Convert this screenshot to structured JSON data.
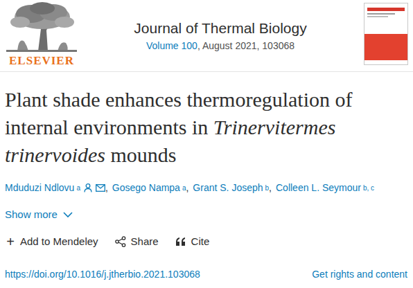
{
  "publisher": {
    "logo_text": "ELSEVIER"
  },
  "journal": {
    "title": "Journal of Thermal Biology",
    "volume_link": "Volume 100",
    "volume_rest": ", August 2021, 103068"
  },
  "article": {
    "title": [
      {
        "text": "Plant shade enhances thermoregulation of internal environments in ",
        "italic": false
      },
      {
        "text": "Trinervitermes trinervoides",
        "italic": true
      },
      {
        "text": " mounds",
        "italic": false
      }
    ]
  },
  "authors": [
    {
      "name": "Mduduzi Ndlovu",
      "sup": "a",
      "corresponding": true,
      "has_email": true,
      "separator": ","
    },
    {
      "name": "Gosego Nampa",
      "sup": "a",
      "corresponding": false,
      "has_email": false,
      "separator": ","
    },
    {
      "name": "Grant S. Joseph",
      "sup": "b",
      "corresponding": false,
      "has_email": false,
      "separator": ","
    },
    {
      "name": "Colleen L. Seymour",
      "sup": "b, c",
      "corresponding": false,
      "has_email": false,
      "separator": ""
    }
  ],
  "show_more": {
    "label": "Show more",
    "expanded": false
  },
  "actions": [
    {
      "kind": "mendeley",
      "icon": "+",
      "label": "Add to Mendeley"
    },
    {
      "kind": "share",
      "icon": "",
      "label": "Share"
    },
    {
      "kind": "cite",
      "icon": "",
      "label": "Cite"
    }
  ],
  "doi": "https://doi.org/10.1016/j.jtherbio.2021.103068",
  "rights": "Get rights and content"
}
